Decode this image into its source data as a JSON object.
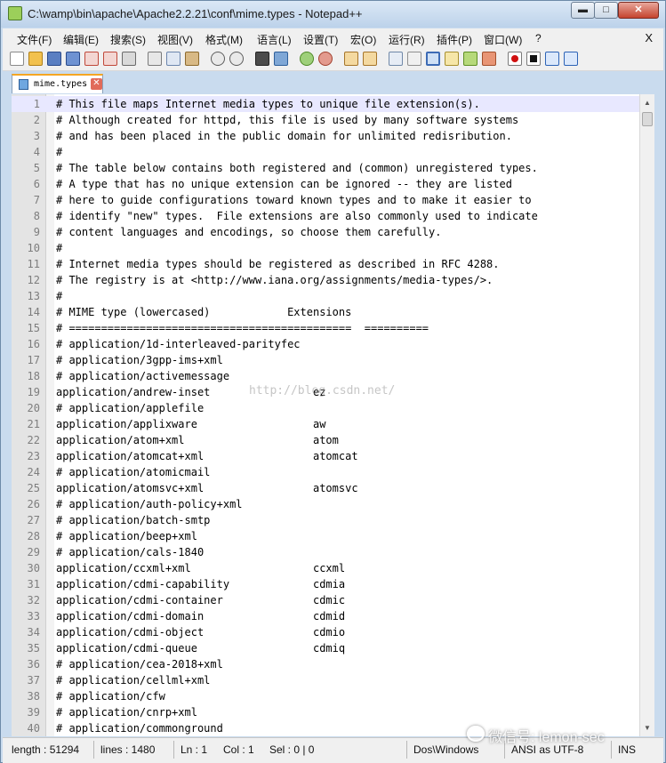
{
  "window": {
    "title": "C:\\wamp\\bin\\apache\\Apache2.2.21\\conf\\mime.types - Notepad++",
    "min_glyph": "▬",
    "max_glyph": "□",
    "close_glyph": "✕"
  },
  "menu": {
    "items": [
      "文件(F)",
      "编辑(E)",
      "搜索(S)",
      "视图(V)",
      "格式(M)",
      "语言(L)",
      "设置(T)",
      "宏(O)",
      "运行(R)",
      "插件(P)",
      "窗口(W)",
      "?"
    ],
    "close_glyph": "X"
  },
  "toolbar": {
    "icons": [
      "new-file-icon",
      "open-file-icon",
      "save-icon",
      "save-all-icon",
      "close-icon",
      "close-all-icon",
      "print-icon",
      "cut-icon",
      "copy-icon",
      "paste-icon",
      "undo-icon",
      "redo-icon",
      "find-icon",
      "replace-icon",
      "zoom-in-icon",
      "zoom-out-icon",
      "sync-v-icon",
      "sync-h-icon",
      "word-wrap-icon",
      "show-all-chars-icon",
      "indent-guide-icon",
      "doc-map-icon",
      "function-list-icon",
      "folder-icon",
      "record-macro-icon",
      "stop-macro-icon",
      "play-macro-icon",
      "run-macro-multiple-icon"
    ]
  },
  "tab": {
    "label": "mime.types",
    "close_glyph": "✕"
  },
  "editor": {
    "lines": [
      {
        "n": "1",
        "t": "# This file maps Internet media types to unique file extension(s)."
      },
      {
        "n": "2",
        "t": "# Although created for httpd, this file is used by many software systems"
      },
      {
        "n": "3",
        "t": "# and has been placed in the public domain for unlimited redisribution."
      },
      {
        "n": "4",
        "t": "#"
      },
      {
        "n": "5",
        "t": "# The table below contains both registered and (common) unregistered types."
      },
      {
        "n": "6",
        "t": "# A type that has no unique extension can be ignored -- they are listed"
      },
      {
        "n": "7",
        "t": "# here to guide configurations toward known types and to make it easier to"
      },
      {
        "n": "8",
        "t": "# identify \"new\" types.  File extensions are also commonly used to indicate"
      },
      {
        "n": "9",
        "t": "# content languages and encodings, so choose them carefully."
      },
      {
        "n": "10",
        "t": "#"
      },
      {
        "n": "11",
        "t": "# Internet media types should be registered as described in RFC 4288."
      },
      {
        "n": "12",
        "t": "# The registry is at <http://www.iana.org/assignments/media-types/>."
      },
      {
        "n": "13",
        "t": "#"
      },
      {
        "n": "14",
        "t": "# MIME type (lowercased)            Extensions"
      },
      {
        "n": "15",
        "t": "# ============================================  =========="
      },
      {
        "n": "16",
        "t": "# application/1d-interleaved-parityfec"
      },
      {
        "n": "17",
        "t": "# application/3gpp-ims+xml"
      },
      {
        "n": "18",
        "t": "# application/activemessage"
      },
      {
        "n": "19",
        "t": "application/andrew-inset                ez"
      },
      {
        "n": "20",
        "t": "# application/applefile"
      },
      {
        "n": "21",
        "t": "application/applixware                  aw"
      },
      {
        "n": "22",
        "t": "application/atom+xml                    atom"
      },
      {
        "n": "23",
        "t": "application/atomcat+xml                 atomcat"
      },
      {
        "n": "24",
        "t": "# application/atomicmail"
      },
      {
        "n": "25",
        "t": "application/atomsvc+xml                 atomsvc"
      },
      {
        "n": "26",
        "t": "# application/auth-policy+xml"
      },
      {
        "n": "27",
        "t": "# application/batch-smtp"
      },
      {
        "n": "28",
        "t": "# application/beep+xml"
      },
      {
        "n": "29",
        "t": "# application/cals-1840"
      },
      {
        "n": "30",
        "t": "application/ccxml+xml                   ccxml"
      },
      {
        "n": "31",
        "t": "application/cdmi-capability             cdmia"
      },
      {
        "n": "32",
        "t": "application/cdmi-container              cdmic"
      },
      {
        "n": "33",
        "t": "application/cdmi-domain                 cdmid"
      },
      {
        "n": "34",
        "t": "application/cdmi-object                 cdmio"
      },
      {
        "n": "35",
        "t": "application/cdmi-queue                  cdmiq"
      },
      {
        "n": "36",
        "t": "# application/cea-2018+xml"
      },
      {
        "n": "37",
        "t": "# application/cellml+xml"
      },
      {
        "n": "38",
        "t": "# application/cfw"
      },
      {
        "n": "39",
        "t": "# application/cnrp+xml"
      },
      {
        "n": "40",
        "t": "# application/commonground"
      }
    ]
  },
  "status": {
    "length": "length : 51294",
    "lines": "lines : 1480",
    "ln": "Ln : 1",
    "col": "Col : 1",
    "sel": "Sel : 0 | 0",
    "eol": "Dos\\Windows",
    "encoding": "ANSI as UTF-8",
    "mode": "INS"
  },
  "watermarks": {
    "blog": "http://blog.csdn.net/",
    "wechat": "微信号: lemon-sec"
  },
  "colors": {
    "frame": "#c9dbee",
    "current_line": "#e8e8ff",
    "gutter": "#e4e4e4"
  }
}
